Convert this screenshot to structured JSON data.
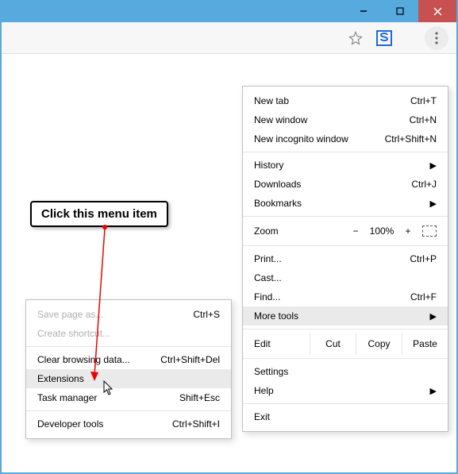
{
  "titlebar": {
    "minimize": "_",
    "maximize": "□",
    "close": "×"
  },
  "menu": {
    "new_tab": "New tab",
    "new_tab_sc": "Ctrl+T",
    "new_window": "New window",
    "new_window_sc": "Ctrl+N",
    "new_incognito": "New incognito window",
    "new_incognito_sc": "Ctrl+Shift+N",
    "history": "History",
    "downloads": "Downloads",
    "downloads_sc": "Ctrl+J",
    "bookmarks": "Bookmarks",
    "zoom_label": "Zoom",
    "zoom_minus": "−",
    "zoom_value": "100%",
    "zoom_plus": "+",
    "print": "Print...",
    "print_sc": "Ctrl+P",
    "cast": "Cast...",
    "find": "Find...",
    "find_sc": "Ctrl+F",
    "more_tools": "More tools",
    "edit": "Edit",
    "cut": "Cut",
    "copy": "Copy",
    "paste": "Paste",
    "settings": "Settings",
    "help": "Help",
    "exit": "Exit"
  },
  "submenu": {
    "save_page": "Save page as...",
    "save_page_sc": "Ctrl+S",
    "create_shortcut": "Create shortcut...",
    "clear_data": "Clear browsing data...",
    "clear_data_sc": "Ctrl+Shift+Del",
    "extensions": "Extensions",
    "task_manager": "Task manager",
    "task_manager_sc": "Shift+Esc",
    "developer_tools": "Developer tools",
    "developer_tools_sc": "Ctrl+Shift+I"
  },
  "callout": {
    "text": "Click this menu item"
  }
}
